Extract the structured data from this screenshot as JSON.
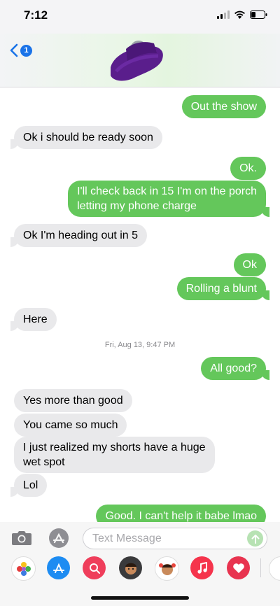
{
  "status": {
    "time": "7:12"
  },
  "header": {
    "back_badge": "1"
  },
  "messages": [
    {
      "dir": "out",
      "text": "Out the show"
    },
    {
      "dir": "in",
      "text": "Ok i should be ready soon"
    },
    {
      "dir": "out",
      "text": "Ok."
    },
    {
      "dir": "out",
      "line1": "I'll check back in 15 I'm on the porch",
      "line2": "letting my phone charge"
    },
    {
      "dir": "in",
      "text": "Ok I'm heading out in 5"
    },
    {
      "dir": "out",
      "text": "Ok"
    },
    {
      "dir": "out",
      "text": "Rolling a blunt"
    },
    {
      "dir": "in",
      "text": "Here"
    },
    {
      "dir": "out",
      "text": "All good?"
    },
    {
      "dir": "in",
      "text": "Yes more than good"
    },
    {
      "dir": "in",
      "text": "You came so much"
    },
    {
      "dir": "in",
      "line1": "I just realized my shorts have a huge",
      "line2": "wet spot"
    },
    {
      "dir": "in",
      "text": "Lol"
    },
    {
      "dir": "out",
      "text": "Good. I can't help it babe lmao"
    }
  ],
  "timestamp": "Fri, Aug 13, 9:47 PM",
  "composer": {
    "placeholder": "Text Message"
  },
  "app_drawer": [
    "photos-icon",
    "app-store-icon",
    "search-images-icon",
    "memoji-icon",
    "memoji-stickers-icon",
    "music-icon",
    "heart-app-icon"
  ]
}
